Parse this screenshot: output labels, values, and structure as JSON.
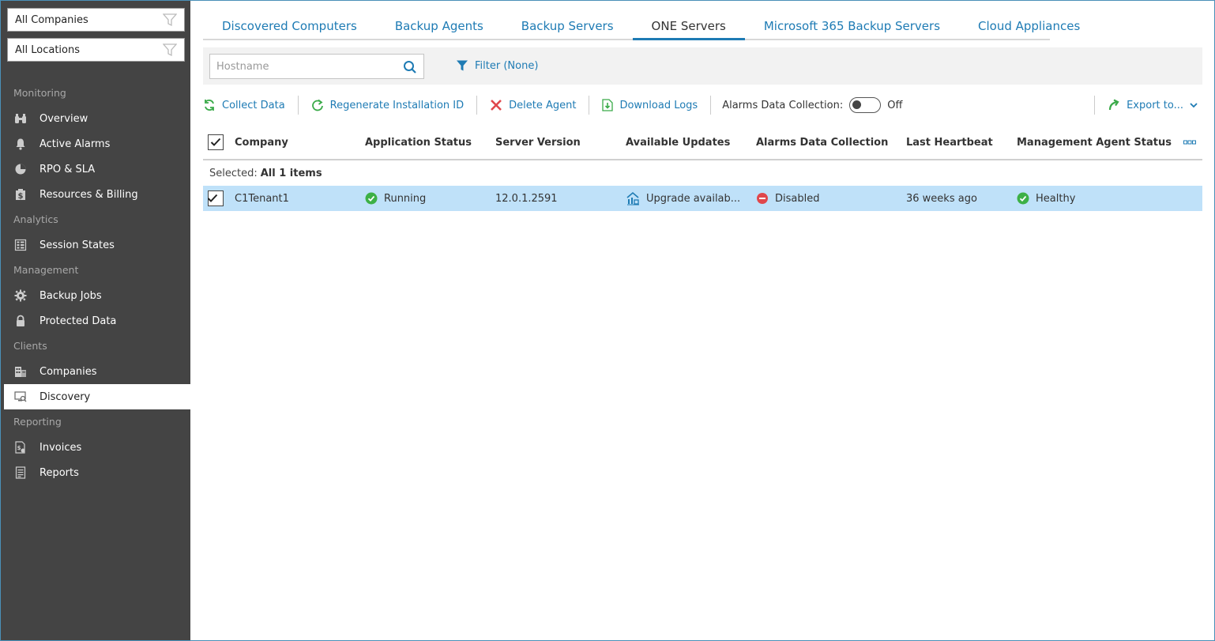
{
  "sidebar": {
    "company_filter": "All Companies",
    "location_filter": "All Locations",
    "sections": [
      {
        "header": "Monitoring",
        "items": [
          {
            "label": "Overview",
            "icon": "binoculars-icon"
          },
          {
            "label": "Active Alarms",
            "icon": "bell-icon"
          },
          {
            "label": "RPO & SLA",
            "icon": "pie-chart-icon"
          },
          {
            "label": "Resources & Billing",
            "icon": "dollar-doc-icon"
          }
        ]
      },
      {
        "header": "Analytics",
        "items": [
          {
            "label": "Session States",
            "icon": "grid-icon"
          }
        ]
      },
      {
        "header": "Management",
        "items": [
          {
            "label": "Backup Jobs",
            "icon": "gear-icon"
          },
          {
            "label": "Protected Data",
            "icon": "lock-icon"
          }
        ]
      },
      {
        "header": "Clients",
        "items": [
          {
            "label": "Companies",
            "icon": "building-icon"
          },
          {
            "label": "Discovery",
            "icon": "monitor-search-icon",
            "active": true
          }
        ]
      },
      {
        "header": "Reporting",
        "items": [
          {
            "label": "Invoices",
            "icon": "invoice-icon"
          },
          {
            "label": "Reports",
            "icon": "report-icon"
          }
        ]
      }
    ]
  },
  "tabs": [
    {
      "label": "Discovered Computers"
    },
    {
      "label": "Backup Agents"
    },
    {
      "label": "Backup Servers"
    },
    {
      "label": "ONE Servers",
      "active": true
    },
    {
      "label": "Microsoft 365 Backup Servers"
    },
    {
      "label": "Cloud Appliances"
    }
  ],
  "search": {
    "placeholder": "Hostname",
    "value": ""
  },
  "filter": {
    "label": "Filter (None)"
  },
  "toolbar": {
    "collect_data": "Collect Data",
    "regenerate_id": "Regenerate Installation ID",
    "delete_agent": "Delete Agent",
    "download_logs": "Download Logs",
    "alarms_label": "Alarms Data Collection:",
    "alarms_state": "Off",
    "export": "Export to..."
  },
  "grid": {
    "columns": [
      "Company",
      "Application Status",
      "Server Version",
      "Available Updates",
      "Alarms Data Collection",
      "Last Heartbeat",
      "Management Agent Status"
    ],
    "selected_prefix": "Selected:",
    "selected_value": "All 1 items",
    "rows": [
      {
        "company": "C1Tenant1",
        "app_status": "Running",
        "server_version": "12.0.1.2591",
        "updates": "Upgrade availab...",
        "alarms": "Disabled",
        "heartbeat": "36 weeks ago",
        "agent_status": "Healthy"
      }
    ]
  },
  "colors": {
    "accent": "#1e7bb4",
    "sidebar_bg": "#444444",
    "row_selected": "#bfe1f9",
    "status_ok": "#3db046",
    "status_disabled": "#e0474c",
    "collect_green": "#3aaa49",
    "delete_red": "#e0474c"
  }
}
